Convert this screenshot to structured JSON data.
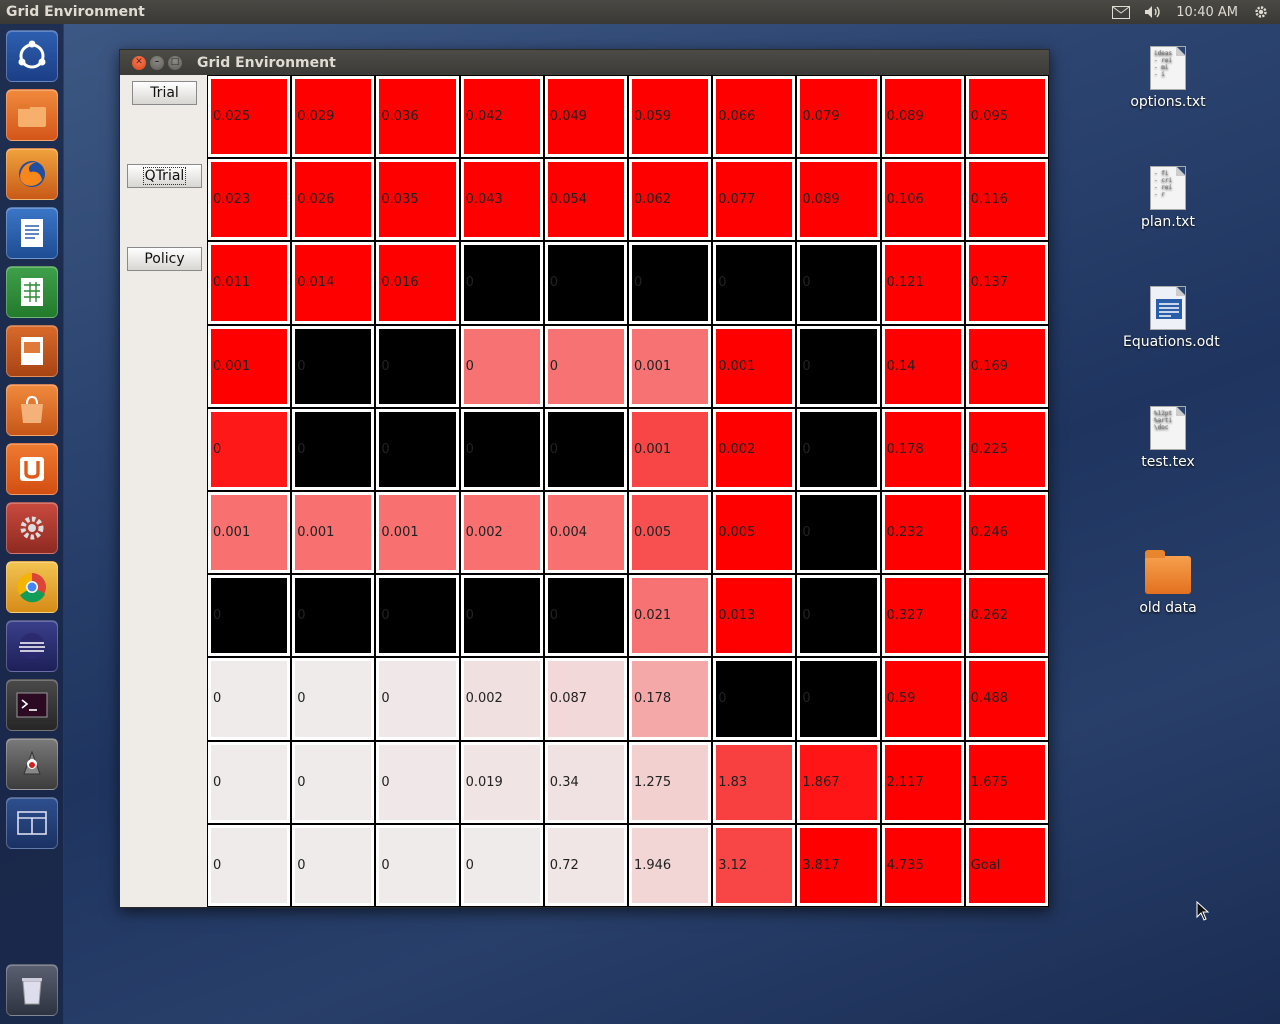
{
  "topbar": {
    "app_title": "Grid Environment",
    "time": "10:40 AM"
  },
  "launcher": {
    "items": [
      "dash-icon",
      "files-icon",
      "firefox-icon",
      "writer-icon",
      "calc-icon",
      "impress-icon",
      "software-center-icon",
      "ubuntu-one-icon",
      "system-settings-icon",
      "chrome-icon",
      "eclipse-icon",
      "terminal-icon",
      "java-icon",
      "workspace-switcher-icon"
    ],
    "trash": "trash-icon"
  },
  "desktop": {
    "icons": [
      {
        "label": "options.txt",
        "type": "text-file-icon",
        "preview": "ideas\n- rei\n- mi\n- i"
      },
      {
        "label": "plan.txt",
        "type": "text-file-icon",
        "preview": "- fi\n- cri\n- rei\n- r"
      },
      {
        "label": "Equations.odt",
        "type": "odt-file-icon",
        "preview": ""
      },
      {
        "label": "test.tex",
        "type": "tex-file-icon",
        "preview": "%12pt\n%arti\n\\doc"
      },
      {
        "label": "old data",
        "type": "folder-icon",
        "preview": ""
      }
    ]
  },
  "window": {
    "title": "Grid Environment",
    "buttons": {
      "trial": "Trial",
      "qtrial": "QTrial",
      "policy": "Policy"
    },
    "grid": [
      [
        "0.025",
        "0.029",
        "0.036",
        "0.042",
        "0.049",
        "0.059",
        "0.066",
        "0.079",
        "0.089",
        "0.095"
      ],
      [
        "0.023",
        "0.026",
        "0.035",
        "0.043",
        "0.054",
        "0.062",
        "0.077",
        "0.089",
        "0.106",
        "0.116"
      ],
      [
        "0.011",
        "0.014",
        "0.016",
        "0",
        "0",
        "0",
        "0",
        "0",
        "0.121",
        "0.137"
      ],
      [
        "0.001",
        "0",
        "0",
        "0",
        "0",
        "0.001",
        "0.001",
        "0",
        "0.14",
        "0.169"
      ],
      [
        "0",
        "0",
        "0",
        "0",
        "0",
        "0.001",
        "0.002",
        "0",
        "0.178",
        "0.225"
      ],
      [
        "0.001",
        "0.001",
        "0.001",
        "0.002",
        "0.004",
        "0.005",
        "0.005",
        "0",
        "0.232",
        "0.246"
      ],
      [
        "0",
        "0",
        "0",
        "0",
        "0",
        "0.021",
        "0.013",
        "0",
        "0.327",
        "0.262"
      ],
      [
        "0",
        "0",
        "0",
        "0.002",
        "0.087",
        "0.178",
        "0",
        "0",
        "0.59",
        "0.488"
      ],
      [
        "0",
        "0",
        "0",
        "0.019",
        "0.34",
        "1.275",
        "1.83",
        "1.867",
        "2.117",
        "1.675"
      ],
      [
        "0",
        "0",
        "0",
        "0",
        "0.72",
        "1.946",
        "3.12",
        "3.817",
        "4.735",
        "Goal"
      ]
    ],
    "colors": [
      [
        "#ff0000",
        "#ff0000",
        "#ff0000",
        "#ff0000",
        "#ff0000",
        "#ff0000",
        "#ff0000",
        "#ff0000",
        "#ff0000",
        "#ff0000"
      ],
      [
        "#ff0000",
        "#ff0000",
        "#ff0000",
        "#ff0000",
        "#ff0000",
        "#ff0000",
        "#ff0000",
        "#ff0000",
        "#ff0000",
        "#ff0000"
      ],
      [
        "#ff0000",
        "#ff0000",
        "#ff0000",
        "#000000",
        "#000000",
        "#000000",
        "#000000",
        "#000000",
        "#ff0000",
        "#ff0000"
      ],
      [
        "#ff0000",
        "#000000",
        "#000000",
        "#f77272",
        "#f77272",
        "#f77272",
        "#ff0000",
        "#000000",
        "#ff0000",
        "#ff0000"
      ],
      [
        "#ff1818",
        "#000000",
        "#000000",
        "#000000",
        "#000000",
        "#f84545",
        "#ff0000",
        "#000000",
        "#ff0000",
        "#ff0000"
      ],
      [
        "#f87070",
        "#f87070",
        "#f87070",
        "#f87070",
        "#f87070",
        "#f85050",
        "#ff0000",
        "#000000",
        "#ff0000",
        "#ff0000"
      ],
      [
        "#000000",
        "#000000",
        "#000000",
        "#000000",
        "#000000",
        "#f77272",
        "#ff0000",
        "#000000",
        "#ff0000",
        "#ff0000"
      ],
      [
        "#efebeb",
        "#efebeb",
        "#f0e8e8",
        "#f1e0e0",
        "#f2d8d8",
        "#f4a8a8",
        "#000000",
        "#000000",
        "#ff0000",
        "#ff0000"
      ],
      [
        "#efebeb",
        "#efebeb",
        "#f0e8e8",
        "#f0e4e4",
        "#f0e2e2",
        "#f2d0d0",
        "#f84040",
        "#ff1515",
        "#ff0000",
        "#ff0000"
      ],
      [
        "#efebeb",
        "#efebeb",
        "#efebeb",
        "#efebeb",
        "#f1e6e6",
        "#f2d6d6",
        "#f84545",
        "#ff0000",
        "#ff0000",
        "#ff0000"
      ]
    ]
  }
}
